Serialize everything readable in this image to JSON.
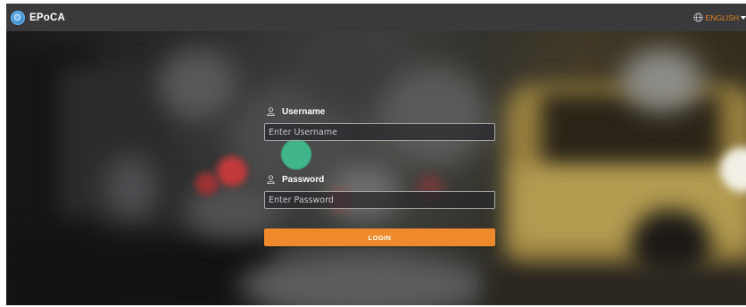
{
  "header": {
    "brand_name": "EPoCA",
    "language_label": "ENGLISH",
    "language_color": "#e6821e",
    "brand_logo_icon": "globe-logo-icon",
    "language_icon": "globe-icon",
    "dropdown_icon": "caret-down-icon"
  },
  "login": {
    "username_label": "Username",
    "username_placeholder": "Enter Username",
    "username_value": "",
    "password_label": "Password",
    "password_placeholder": "Enter Password",
    "password_value": "",
    "login_label": "LOGIN",
    "field_icon": "user-icon",
    "accent_color": "#ef8a2c"
  },
  "overlay": {
    "indicator_color": "#3fbf8f"
  }
}
